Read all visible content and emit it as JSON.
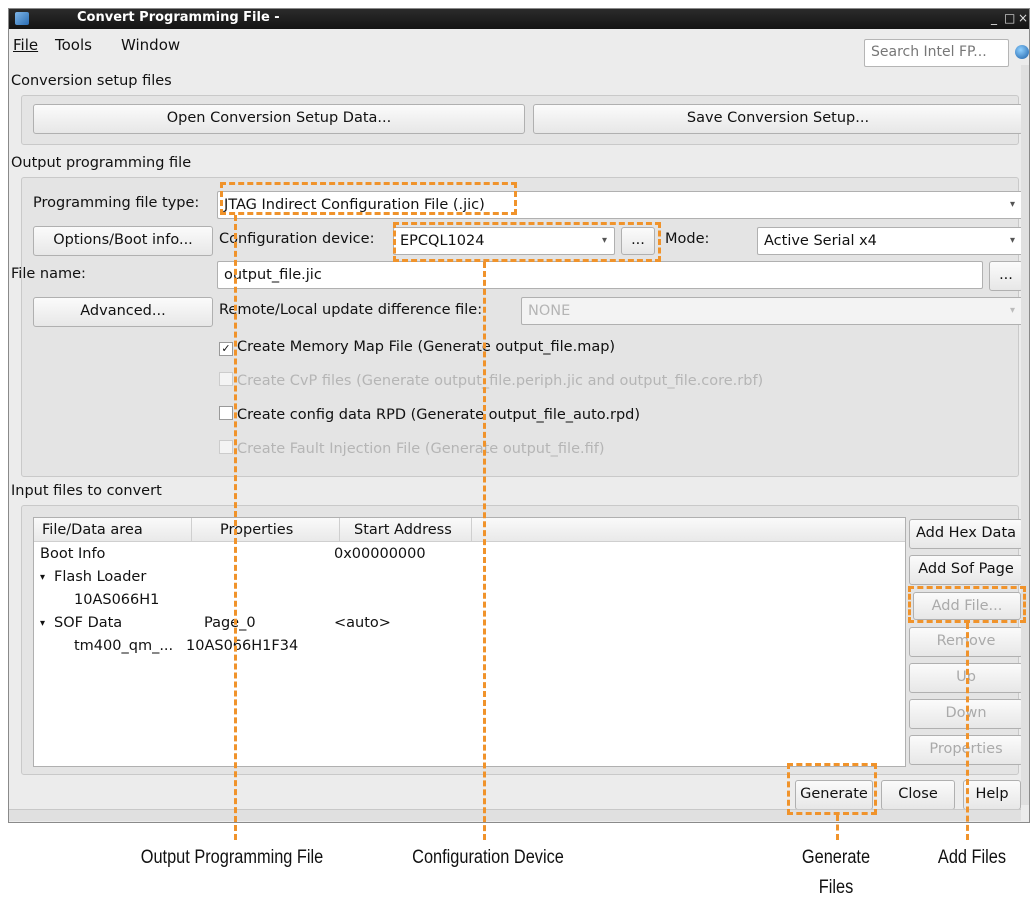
{
  "window": {
    "title": "Convert Programming File -",
    "controls": [
      "_",
      "□",
      "×"
    ]
  },
  "menu": {
    "file": "File",
    "tools": "Tools",
    "window": "Window"
  },
  "search": {
    "placeholder": "Search Intel FP..."
  },
  "setup": {
    "label": "Conversion setup files",
    "open_button": "Open Conversion Setup Data...",
    "save_button": "Save Conversion Setup..."
  },
  "output": {
    "label": "Output programming file",
    "type_label": "Programming file type:",
    "type_value": "JTAG Indirect Configuration File (.jic)",
    "options_button": "Options/Boot info...",
    "config_label": "Configuration device:",
    "config_value": "EPCQL1024",
    "browse_button": "...",
    "mode_label": "Mode:",
    "mode_value": "Active Serial x4",
    "file_name_label": "File name:",
    "file_name_value": "output_file.jic",
    "file_browse_button": "...",
    "advanced_button": "Advanced...",
    "remote_label": "Remote/Local update difference file:",
    "remote_value": "NONE",
    "checkboxes": [
      {
        "label": "Create Memory Map File (Generate output_file.map)",
        "checked": true,
        "enabled": true
      },
      {
        "label": "Create CvP files (Generate output_file.periph.jic and output_file.core.rbf)",
        "checked": false,
        "enabled": false
      },
      {
        "label": "Create config data RPD (Generate output_file_auto.rpd)",
        "checked": false,
        "enabled": true
      },
      {
        "label": "Create Fault Injection File (Generate output_file.fif)",
        "checked": false,
        "enabled": false
      }
    ]
  },
  "input": {
    "label": "Input files to convert",
    "columns": [
      "File/Data area",
      "Properties",
      "Start Address"
    ],
    "rows": [
      {
        "name": "Boot Info",
        "properties": "",
        "address": "0x00000000"
      },
      {
        "name": "Flash Loader",
        "properties": "",
        "address": ""
      },
      {
        "name": "10AS066H1",
        "properties": "",
        "address": ""
      },
      {
        "name": "SOF Data",
        "properties": "Page_0",
        "address": "<auto>"
      },
      {
        "name": "tm400_qm_...",
        "properties": "10AS066H1F34",
        "address": ""
      }
    ],
    "buttons": {
      "add_hex": "Add Hex Data",
      "add_sof": "Add Sof Page",
      "add_file": "Add File...",
      "remove": "Remove",
      "up": "Up",
      "down": "Down",
      "properties": "Properties"
    }
  },
  "footer": {
    "generate": "Generate",
    "close": "Close",
    "help": "Help"
  },
  "callouts": {
    "output_file": "Output Programming File",
    "config_device": "Configuration Device",
    "generate_files": "Generate Files",
    "add_files": "Add Files"
  },
  "colors": {
    "highlight": "#f0932b",
    "titlebar": "#1e1e1e",
    "panel": "#e4e4e4"
  }
}
